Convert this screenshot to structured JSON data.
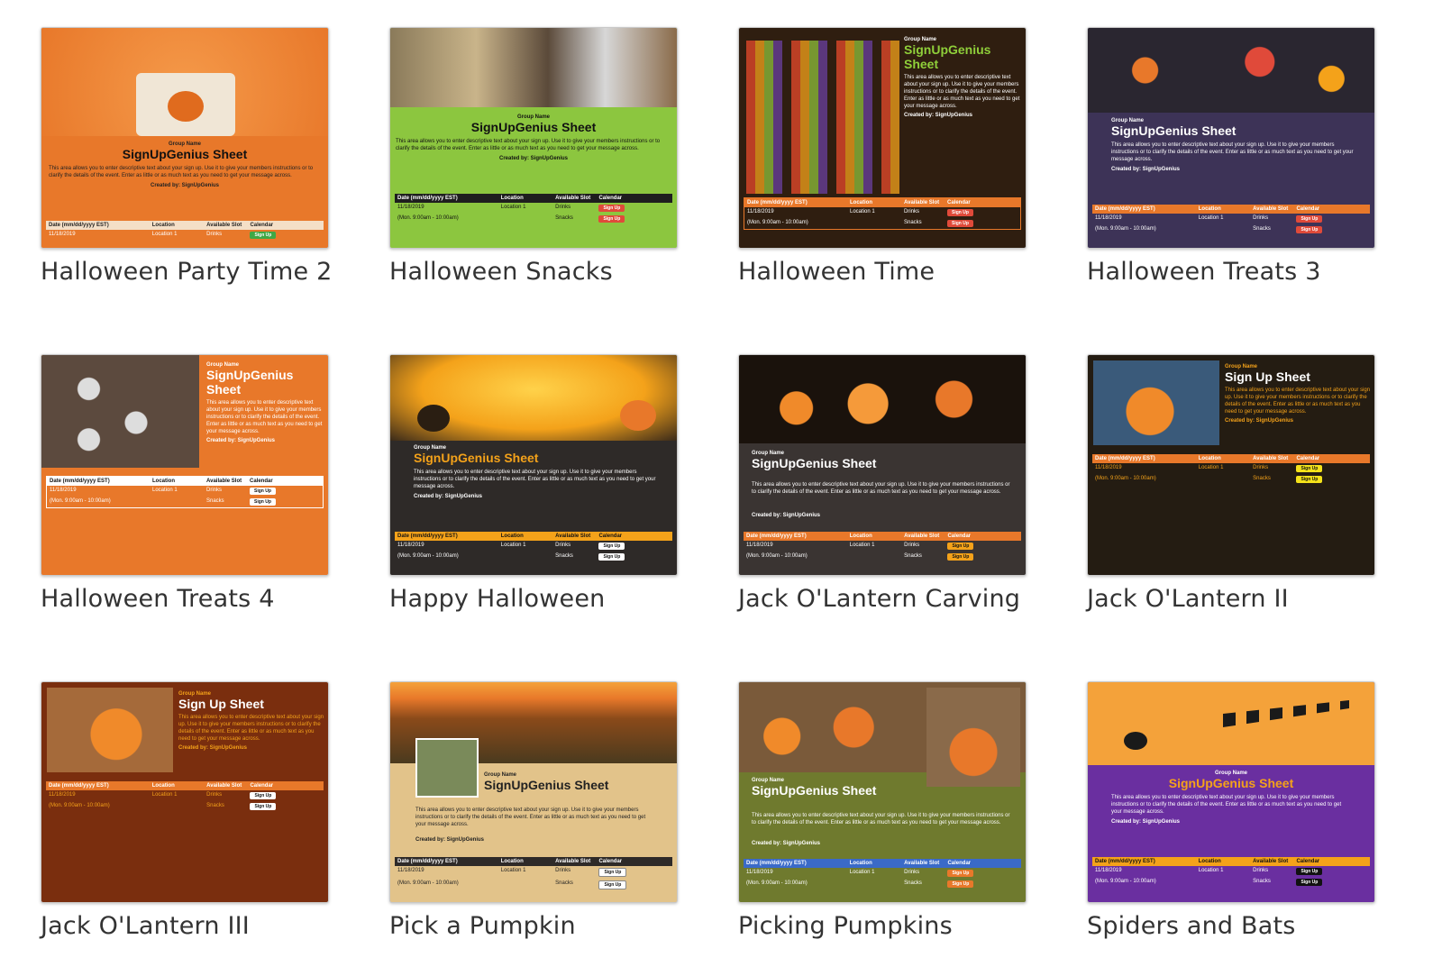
{
  "templates": [
    {
      "name": "Halloween Party Time 2"
    },
    {
      "name": "Halloween Snacks"
    },
    {
      "name": "Halloween Time"
    },
    {
      "name": "Halloween Treats 3"
    },
    {
      "name": "Halloween Treats 4"
    },
    {
      "name": "Happy Halloween"
    },
    {
      "name": "Jack O'Lantern Carving"
    },
    {
      "name": "Jack O'Lantern II"
    },
    {
      "name": "Jack O'Lantern III"
    },
    {
      "name": "Pick a Pumpkin"
    },
    {
      "name": "Picking Pumpkins"
    },
    {
      "name": "Spiders and Bats"
    }
  ],
  "preview": {
    "group_name": "Group Name",
    "title_genius": "SignUpGenius Sheet",
    "title_plain": "Sign Up Sheet",
    "description": "This area allows you to enter descriptive text about your sign up. Use it to give your members instructions or to clarify the details of the event. Enter as little or as much text as you need to get your message across.",
    "created_by": "Created by: SignUpGenius",
    "col_date": "Date (mm/dd/yyyy EST)",
    "col_location": "Location",
    "col_slot": "Available Slot",
    "calendar": "Calendar",
    "date1": "11/18/2019",
    "time1": "(Mon. 9:00am - 10:00am)",
    "location1": "Location 1",
    "slot1": "Drinks",
    "slot2": "Snacks",
    "signup": "Sign Up"
  },
  "colors": {
    "orange": "#e8782a",
    "green": "#8cc63f",
    "dark_brown": "#2f1e10",
    "navy_purple": "#3d3357",
    "charcoal": "#2e2a28",
    "purple": "#6a2fa0",
    "olive": "#6f7a2e",
    "tan": "#e2c38a",
    "rust": "#7a2e0e",
    "signup_red": "#e04a3a",
    "signup_green": "#3fa845"
  }
}
